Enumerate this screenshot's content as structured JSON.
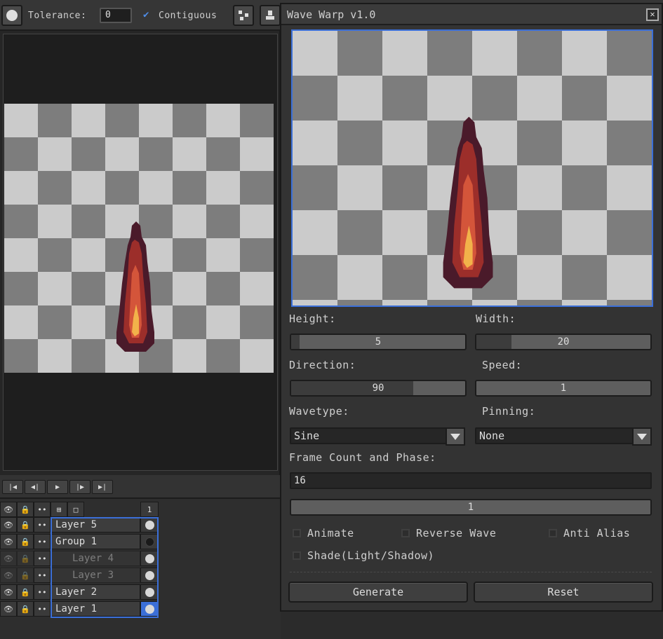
{
  "toolbar": {
    "tolerance_label": "Tolerance:",
    "tolerance_value": "0",
    "contiguous_label": "Contiguous",
    "contiguous_checked": true
  },
  "timeline": {
    "frame_number": "1",
    "layers": [
      {
        "name": "Layer 5",
        "visible": true,
        "locked": true,
        "dimmed": false,
        "indent": false,
        "cel": "filled"
      },
      {
        "name": "Group 1",
        "visible": true,
        "locked": true,
        "dimmed": false,
        "indent": false,
        "cel": "empty"
      },
      {
        "name": "Layer 4",
        "visible": false,
        "locked": false,
        "dimmed": true,
        "indent": true,
        "cel": "filled"
      },
      {
        "name": "Layer 3",
        "visible": false,
        "locked": false,
        "dimmed": true,
        "indent": true,
        "cel": "filled"
      },
      {
        "name": "Layer 2",
        "visible": true,
        "locked": true,
        "dimmed": false,
        "indent": false,
        "cel": "filled"
      },
      {
        "name": "Layer 1",
        "visible": true,
        "locked": true,
        "dimmed": false,
        "indent": false,
        "cel": "selected"
      }
    ]
  },
  "dialog": {
    "title": "Wave Warp v1.0",
    "height_label": "Height:",
    "height_value": "5",
    "height_fraction": 0.05,
    "width_label": "Width:",
    "width_value": "20",
    "width_fraction": 0.2,
    "direction_label": "Direction:",
    "direction_value": "90",
    "direction_fraction": 0.7,
    "speed_label": "Speed:",
    "speed_value": "1",
    "speed_fraction": 0,
    "wavetype_label": "Wavetype:",
    "wavetype_value": "Sine",
    "pinning_label": "Pinning:",
    "pinning_value": "None",
    "frame_label": "Frame Count and Phase:",
    "frame_count": "16",
    "phase_value": "1",
    "animate_label": "Animate",
    "reverse_label": "Reverse Wave",
    "antialias_label": "Anti Alias",
    "shade_label": "Shade(Light/Shadow)",
    "generate_label": "Generate",
    "reset_label": "Reset"
  },
  "colors": {
    "flame_outer": "#4a1a2a",
    "flame_mid": "#9c2e2a",
    "flame_inner": "#d4553a",
    "flame_core": "#f2b24a",
    "selection_accent": "#3b6fd8"
  }
}
